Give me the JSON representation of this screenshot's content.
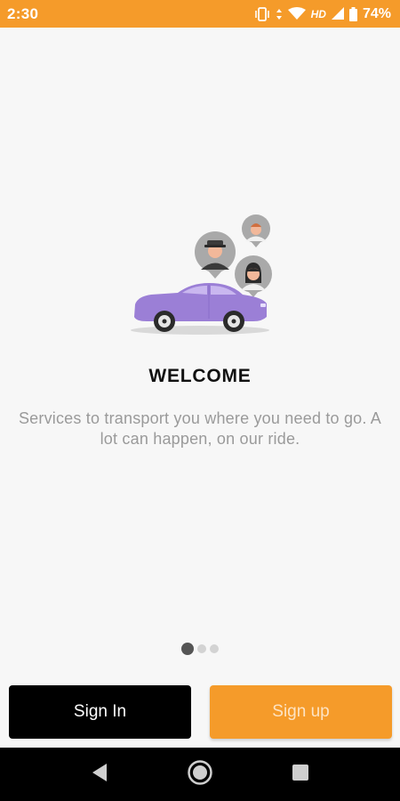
{
  "status_bar": {
    "time": "2:30",
    "hd_label": "HD",
    "battery_percent": "74%",
    "icons": [
      "vibrate-icon",
      "data-arrows-icon",
      "wifi-icon",
      "signal-icon",
      "battery-icon"
    ],
    "background_color": "#f59b2a"
  },
  "illustration": {
    "icons": [
      "car-icon",
      "driver-avatar-icon",
      "passenger-man-avatar-icon",
      "passenger-woman-avatar-icon"
    ],
    "car_color": "#9b7fd6"
  },
  "welcome": {
    "title": "WELCOME",
    "description": "Services to transport you where you need to go. A lot can happen, on our ride."
  },
  "pager": {
    "total_pages": 3,
    "current_page": 1
  },
  "actions": {
    "sign_in_label": "Sign In",
    "sign_up_label": "Sign up",
    "sign_up_color": "#f59b2a"
  },
  "nav_bar": {
    "icons": [
      "back-icon",
      "home-icon",
      "recents-icon"
    ]
  }
}
